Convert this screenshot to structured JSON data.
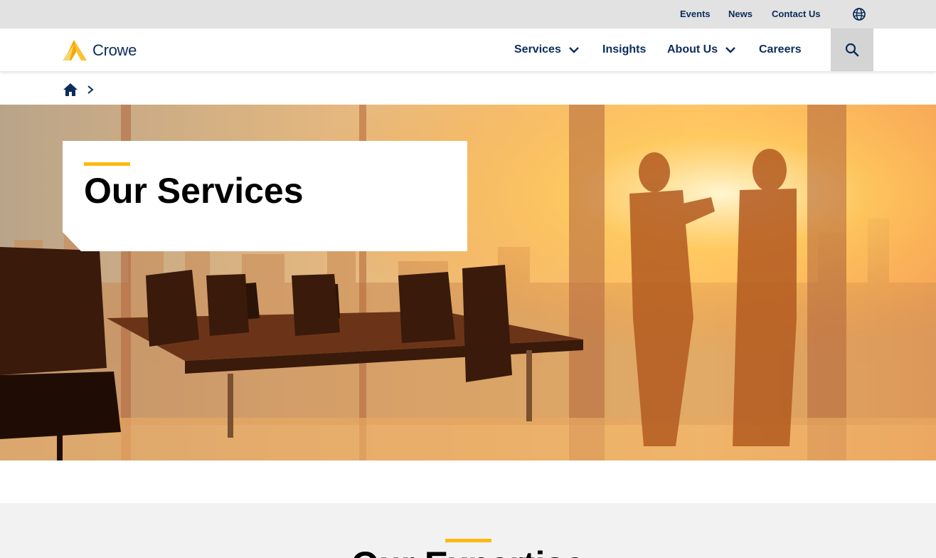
{
  "utility_nav": {
    "links": [
      "Events",
      "News",
      "Contact Us"
    ],
    "globe_icon": "globe-icon"
  },
  "header": {
    "brand": "Crowe",
    "nav": [
      {
        "label": "Services",
        "has_dropdown": true
      },
      {
        "label": "Insights",
        "has_dropdown": false
      },
      {
        "label": "About Us",
        "has_dropdown": true
      },
      {
        "label": "Careers",
        "has_dropdown": false
      }
    ],
    "search_icon": "search-icon"
  },
  "breadcrumb": {
    "home_icon": "home-icon",
    "separator_icon": "chevron-right-icon"
  },
  "hero": {
    "title": "Our Services"
  },
  "expertise": {
    "title": "Our Expertise"
  },
  "colors": {
    "brand_navy": "#0b2d5b",
    "accent_gold": "#fdb913",
    "utility_bg": "#e2e2e2",
    "section_bg": "#f2f2f2"
  }
}
